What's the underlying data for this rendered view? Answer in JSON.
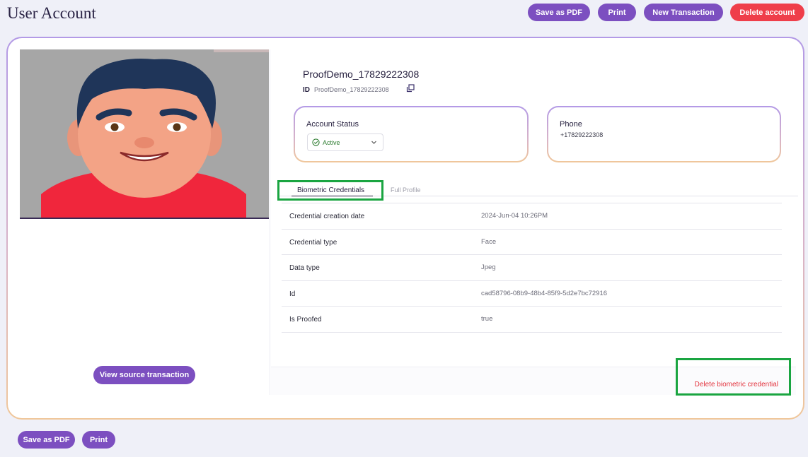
{
  "header": {
    "title": "User Account",
    "buttons": {
      "save_pdf": "Save as PDF",
      "print": "Print",
      "new_transaction": "New Transaction",
      "delete_account": "Delete account"
    }
  },
  "photo_panel": {
    "view_source_label": "View source transaction"
  },
  "account": {
    "name": "ProofDemo_17829222308",
    "id_label": "ID",
    "id_value": "ProofDemo_17829222308",
    "status_label": "Account Status",
    "status_value": "Active",
    "phone_label": "Phone",
    "phone_value": "+17829222308"
  },
  "tabs": [
    {
      "label": "Biometric Credentials",
      "active": true
    },
    {
      "label": "Full Profile",
      "active": false
    }
  ],
  "credentials": [
    {
      "key": "Credential creation date",
      "value": "2024-Jun-04 10:26PM"
    },
    {
      "key": "Credential type",
      "value": "Face"
    },
    {
      "key": "Data type",
      "value": "Jpeg"
    },
    {
      "key": "Id",
      "value": "cad58796-08b9-48b4-85f9-5d2e7bc72916"
    },
    {
      "key": "Is Proofed",
      "value": "true"
    }
  ],
  "delete_credential_label": "Delete biometric credential",
  "footer": {
    "save_pdf": "Save as PDF",
    "print": "Print"
  },
  "colors": {
    "primary": "#7c4fc0",
    "danger": "#ef3e4a",
    "highlight": "#1aa541",
    "active_status": "#2f7d32"
  }
}
